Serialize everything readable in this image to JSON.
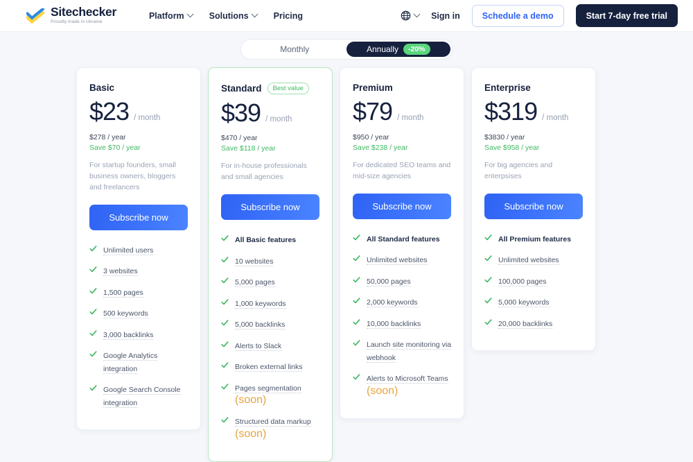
{
  "header": {
    "logo": {
      "name": "Sitechecker",
      "tagline": "Proudly made in Ukraine"
    },
    "nav": [
      {
        "label": "Platform",
        "has_chevron": true
      },
      {
        "label": "Solutions",
        "has_chevron": true
      },
      {
        "label": "Pricing",
        "has_chevron": false
      }
    ],
    "language_icon": "globe-icon",
    "sign_in": "Sign in",
    "demo_button": "Schedule a demo",
    "trial_button": "Start 7-day free trial"
  },
  "billing_toggle": {
    "monthly": "Monthly",
    "annually": "Annually",
    "discount": "-20%",
    "active": "annually"
  },
  "colors": {
    "accent_blue": "#2f63f4",
    "dark_navy": "#16213e",
    "green": "#3fb862",
    "discount_green": "#5ad67d",
    "soon_orange": "#e8a33d",
    "page_bg": "#f5f7fa"
  },
  "subscribe_label": "Subscribe now",
  "plans": [
    {
      "name": "Basic",
      "badge": null,
      "featured": false,
      "price": "$23",
      "per": "/ month",
      "yearly": "$278 / year",
      "save": "Save $70 / year",
      "description": "For startup founders, small business owners, bloggers and freelancers",
      "features": [
        {
          "text": "Unlimited users",
          "bold": false,
          "dotted": true,
          "soon": null
        },
        {
          "text": "3 websites",
          "bold": false,
          "dotted": true,
          "soon": null
        },
        {
          "text": "1,500 pages",
          "bold": false,
          "dotted": true,
          "soon": null
        },
        {
          "text": "500 keywords",
          "bold": false,
          "dotted": true,
          "soon": null
        },
        {
          "text": "3,000 backlinks",
          "bold": false,
          "dotted": true,
          "soon": null
        },
        {
          "text": "Google Analytics integration",
          "bold": false,
          "dotted": true,
          "soon": null
        },
        {
          "text": "Google Search Console integration",
          "bold": false,
          "dotted": true,
          "soon": null
        }
      ]
    },
    {
      "name": "Standard",
      "badge": "Best value",
      "featured": true,
      "price": "$39",
      "per": "/ month",
      "yearly": "$470 / year",
      "save": "Save $118 / year",
      "description": "For in-house professionals and small agencies",
      "features": [
        {
          "text": "All Basic features",
          "bold": true,
          "dotted": false,
          "soon": null
        },
        {
          "text": "10 websites",
          "bold": false,
          "dotted": true,
          "soon": null
        },
        {
          "text": "5,000 pages",
          "bold": false,
          "dotted": true,
          "soon": null
        },
        {
          "text": "1,000 keywords",
          "bold": false,
          "dotted": true,
          "soon": null
        },
        {
          "text": "5,000 backlinks",
          "bold": false,
          "dotted": true,
          "soon": null
        },
        {
          "text": "Alerts to Slack",
          "bold": false,
          "dotted": true,
          "soon": null
        },
        {
          "text": "Broken external links",
          "bold": false,
          "dotted": true,
          "soon": null
        },
        {
          "text": "Pages segmentation",
          "bold": false,
          "dotted": true,
          "soon": "(soon)"
        },
        {
          "text": "Structured data markup",
          "bold": false,
          "dotted": true,
          "soon": "(soon)"
        }
      ]
    },
    {
      "name": "Premium",
      "badge": null,
      "featured": false,
      "price": "$79",
      "per": "/ month",
      "yearly": "$950 / year",
      "save": "Save $238 / year",
      "description": "For dedicated SEO teams and mid-size agencies",
      "features": [
        {
          "text": "All Standard features",
          "bold": true,
          "dotted": false,
          "soon": null
        },
        {
          "text": "Unlimited websites",
          "bold": false,
          "dotted": true,
          "soon": null
        },
        {
          "text": "50,000 pages",
          "bold": false,
          "dotted": true,
          "soon": null
        },
        {
          "text": "2,000 keywords",
          "bold": false,
          "dotted": true,
          "soon": null
        },
        {
          "text": "10,000 backlinks",
          "bold": false,
          "dotted": true,
          "soon": null
        },
        {
          "text": "Launch site monitoring via webhook",
          "bold": false,
          "dotted": true,
          "soon": null
        },
        {
          "text": "Alerts to Microsoft Teams",
          "bold": false,
          "dotted": true,
          "soon": "(soon)"
        }
      ]
    },
    {
      "name": "Enterprise",
      "badge": null,
      "featured": false,
      "price": "$319",
      "per": "/ month",
      "yearly": "$3830 / year",
      "save": "Save $958 / year",
      "description": "For big agencies and enterpsises",
      "features": [
        {
          "text": "All Premium features",
          "bold": true,
          "dotted": false,
          "soon": null
        },
        {
          "text": "Unlimited websites",
          "bold": false,
          "dotted": true,
          "soon": null
        },
        {
          "text": "100,000 pages",
          "bold": false,
          "dotted": true,
          "soon": null
        },
        {
          "text": "5,000 keywords",
          "bold": false,
          "dotted": true,
          "soon": null
        },
        {
          "text": "20,000 backlinks",
          "bold": false,
          "dotted": true,
          "soon": null
        }
      ]
    }
  ]
}
